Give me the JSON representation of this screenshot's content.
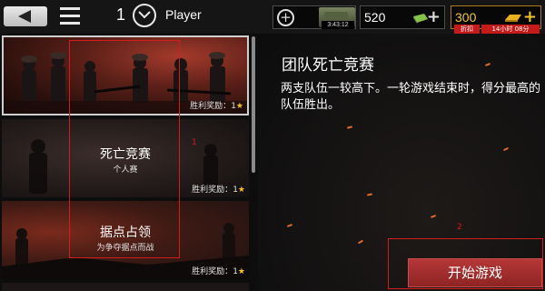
{
  "topbar": {
    "rank": "1",
    "player_name": "Player",
    "timer": "3:43:12",
    "cash": "520",
    "gold": "300",
    "sale_label": "折扣",
    "sale_time": "14小时 08分"
  },
  "modes": [
    {
      "title": "",
      "subtitle": "",
      "reward_label": "胜利奖励：",
      "reward_value": "1"
    },
    {
      "title": "死亡竞赛",
      "subtitle": "个人赛",
      "reward_label": "胜利奖励：",
      "reward_value": "1"
    },
    {
      "title": "据点占领",
      "subtitle": "为争夺据点而战",
      "reward_label": "胜利奖励：",
      "reward_value": "1"
    }
  ],
  "annotations": {
    "one": "1",
    "two": "2"
  },
  "detail": {
    "title": "团队死亡竞赛",
    "description": "两支队伍一较高下。一轮游戏结束时，得分最高的队伍胜出。"
  },
  "start_button": "开始游戏",
  "colors": {
    "accent_red": "#a82d2d",
    "gold": "#f1c63c",
    "annotation": "#d21d1d"
  }
}
